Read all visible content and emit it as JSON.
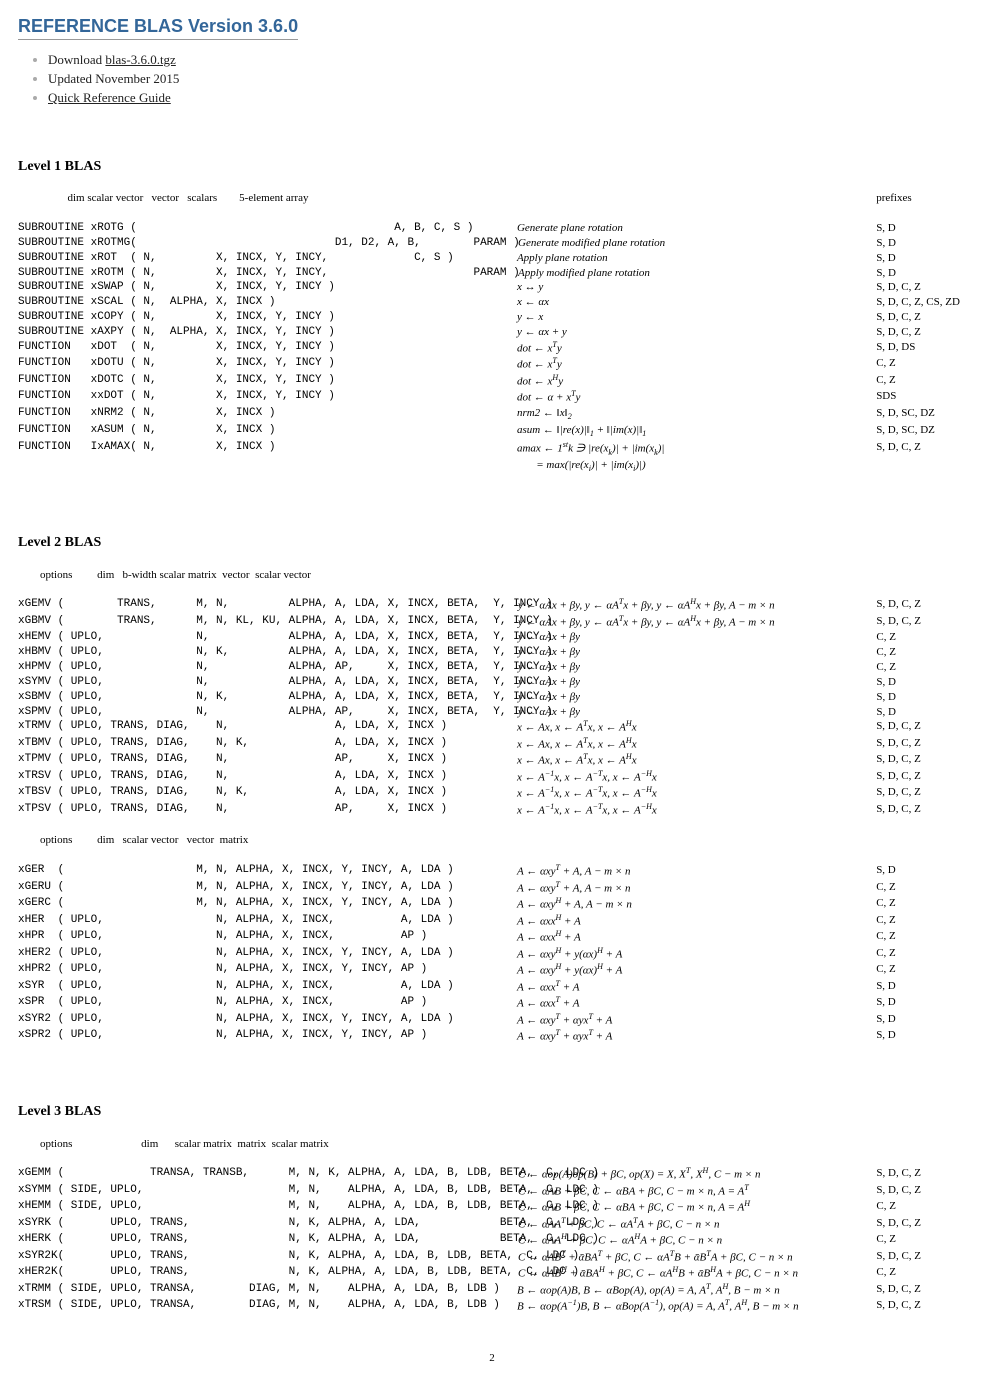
{
  "header": {
    "title": "REFERENCE BLAS Version 3.6.0",
    "items": [
      {
        "pre": "Download ",
        "link": "blas-3.6.0.tgz"
      },
      {
        "text": "Updated November 2015"
      },
      {
        "link": "Quick Reference Guide"
      }
    ]
  },
  "page_number": "2",
  "level1": {
    "title": "Level 1 BLAS",
    "header_c1": "                  dim scalar vector   vector   scalars        5-element array",
    "header_c3": "prefixes",
    "rows": [
      {
        "c1": "SUBROUTINE xROTG (                                       A, B, C, S )",
        "c2": "Generate plane rotation",
        "c3": "S, D"
      },
      {
        "c1": "SUBROUTINE xROTMG(                              D1, D2, A, B,        PARAM )",
        "c2": "Generate modified plane rotation",
        "c3": "S, D"
      },
      {
        "c1": "SUBROUTINE xROT  ( N,         X, INCX, Y, INCY,             C, S )",
        "c2": "Apply plane rotation",
        "c3": "S, D"
      },
      {
        "c1": "SUBROUTINE xROTM ( N,         X, INCX, Y, INCY,                      PARAM )",
        "c2": "Apply modified plane rotation",
        "c3": "S, D"
      },
      {
        "c1": "SUBROUTINE xSWAP ( N,         X, INCX, Y, INCY )",
        "c2": "x ↔ y",
        "c3": "S, D, C, Z"
      },
      {
        "c1": "SUBROUTINE xSCAL ( N,  ALPHA, X, INCX )",
        "c2": "x ← αx",
        "c3": "S, D, C, Z, CS, ZD"
      },
      {
        "c1": "SUBROUTINE xCOPY ( N,         X, INCX, Y, INCY )",
        "c2": "y ← x",
        "c3": "S, D, C, Z"
      },
      {
        "c1": "SUBROUTINE xAXPY ( N,  ALPHA, X, INCX, Y, INCY )",
        "c2": "y ← αx + y",
        "c3": "S, D, C, Z"
      },
      {
        "c1": "FUNCTION   xDOT  ( N,         X, INCX, Y, INCY )",
        "c2": "dot ← x<sup>T</sup>y",
        "c3": "S, D, DS"
      },
      {
        "c1": "FUNCTION   xDOTU ( N,         X, INCX, Y, INCY )",
        "c2": "dot ← x<sup>T</sup>y",
        "c3": "C, Z"
      },
      {
        "c1": "FUNCTION   xDOTC ( N,         X, INCX, Y, INCY )",
        "c2": "dot ← x<sup>H</sup>y",
        "c3": "C, Z"
      },
      {
        "c1": "FUNCTION   xxDOT ( N,         X, INCX, Y, INCY )",
        "c2": "dot ← α + x<sup>T</sup>y",
        "c3": "SDS"
      },
      {
        "c1": "FUNCTION   xNRM2 ( N,         X, INCX )",
        "c2": "nrm2 ← ‖x‖<sub>2</sub>",
        "c3": "S, D, SC, DZ"
      },
      {
        "c1": "FUNCTION   xASUM ( N,         X, INCX )",
        "c2": "asum ← ‖|re(x)|‖<sub>1</sub> + ‖|im(x)|‖<sub>1</sub>",
        "c3": "S, D, SC, DZ"
      },
      {
        "c1": "FUNCTION   IxAMAX( N,         X, INCX )",
        "c2": "amax ← 1<sup>st</sup>k ∋ |re(x<sub>k</sub>)| + |im(x<sub>k</sub>)|",
        "c3": "S, D, C, Z"
      },
      {
        "c1": "",
        "c2": "&nbsp;&nbsp;&nbsp;&nbsp;&nbsp;&nbsp;&nbsp;= max(|re(x<sub>i</sub>)| + |im(x<sub>i</sub>)|)",
        "c3": ""
      }
    ]
  },
  "level2": {
    "title": "Level 2 BLAS",
    "header_c1a": "        options         dim   b-width scalar matrix  vector  scalar vector",
    "header_c1b": "        options         dim   scalar vector   vector  matrix",
    "rows_a": [
      {
        "c1": "xGEMV (        TRANS,      M, N,         ALPHA, A, LDA, X, INCX, BETA,  Y, INCY )",
        "c2": "y ← αAx + βy, y ← αA<sup>T</sup>x + βy, y ← αA<sup>H</sup>x + βy, A − m × n",
        "c3": "S, D, C, Z"
      },
      {
        "c1": "xGBMV (        TRANS,      M, N, KL, KU, ALPHA, A, LDA, X, INCX, BETA,  Y, INCY )",
        "c2": "y ← αAx + βy, y ← αA<sup>T</sup>x + βy, y ← αA<sup>H</sup>x + βy, A − m × n",
        "c3": "S, D, C, Z"
      },
      {
        "c1": "xHEMV ( UPLO,              N,            ALPHA, A, LDA, X, INCX, BETA,  Y, INCY )",
        "c2": "y ← αAx + βy",
        "c3": "C, Z"
      },
      {
        "c1": "xHBMV ( UPLO,              N, K,         ALPHA, A, LDA, X, INCX, BETA,  Y, INCY )",
        "c2": "y ← αAx + βy",
        "c3": "C, Z"
      },
      {
        "c1": "xHPMV ( UPLO,              N,            ALPHA, AP,     X, INCX, BETA,  Y, INCY )",
        "c2": "y ← αAx + βy",
        "c3": "C, Z"
      },
      {
        "c1": "xSYMV ( UPLO,              N,            ALPHA, A, LDA, X, INCX, BETA,  Y, INCY )",
        "c2": "y ← αAx + βy",
        "c3": "S, D"
      },
      {
        "c1": "xSBMV ( UPLO,              N, K,         ALPHA, A, LDA, X, INCX, BETA,  Y, INCY )",
        "c2": "y ← αAx + βy",
        "c3": "S, D"
      },
      {
        "c1": "xSPMV ( UPLO,              N,            ALPHA, AP,     X, INCX, BETA,  Y, INCY )",
        "c2": "y ← αAx + βy",
        "c3": "S, D"
      },
      {
        "c1": "xTRMV ( UPLO, TRANS, DIAG,    N,                A, LDA, X, INCX )",
        "c2": "x ← Ax, x ← A<sup>T</sup>x, x ← A<sup>H</sup>x",
        "c3": "S, D, C, Z"
      },
      {
        "c1": "xTBMV ( UPLO, TRANS, DIAG,    N, K,             A, LDA, X, INCX )",
        "c2": "x ← Ax, x ← A<sup>T</sup>x, x ← A<sup>H</sup>x",
        "c3": "S, D, C, Z"
      },
      {
        "c1": "xTPMV ( UPLO, TRANS, DIAG,    N,                AP,     X, INCX )",
        "c2": "x ← Ax, x ← A<sup>T</sup>x, x ← A<sup>H</sup>x",
        "c3": "S, D, C, Z"
      },
      {
        "c1": "xTRSV ( UPLO, TRANS, DIAG,    N,                A, LDA, X, INCX )",
        "c2": "x ← A<sup>−1</sup>x, x ← A<sup>−T</sup>x, x ← A<sup>−H</sup>x",
        "c3": "S, D, C, Z"
      },
      {
        "c1": "xTBSV ( UPLO, TRANS, DIAG,    N, K,             A, LDA, X, INCX )",
        "c2": "x ← A<sup>−1</sup>x, x ← A<sup>−T</sup>x, x ← A<sup>−H</sup>x",
        "c3": "S, D, C, Z"
      },
      {
        "c1": "xTPSV ( UPLO, TRANS, DIAG,    N,                AP,     X, INCX )",
        "c2": "x ← A<sup>−1</sup>x, x ← A<sup>−T</sup>x, x ← A<sup>−H</sup>x",
        "c3": "S, D, C, Z"
      }
    ],
    "rows_b": [
      {
        "c1": "xGER  (                    M, N, ALPHA, X, INCX, Y, INCY, A, LDA )",
        "c2": "A ← αxy<sup>T</sup> + A, A − m × n",
        "c3": "S, D"
      },
      {
        "c1": "xGERU (                    M, N, ALPHA, X, INCX, Y, INCY, A, LDA )",
        "c2": "A ← αxy<sup>T</sup> + A, A − m × n",
        "c3": "C, Z"
      },
      {
        "c1": "xGERC (                    M, N, ALPHA, X, INCX, Y, INCY, A, LDA )",
        "c2": "A ← αxy<sup>H</sup> + A, A − m × n",
        "c3": "C, Z"
      },
      {
        "c1": "xHER  ( UPLO,                 N, ALPHA, X, INCX,          A, LDA )",
        "c2": "A ← αxx<sup>H</sup> + A",
        "c3": "C, Z"
      },
      {
        "c1": "xHPR  ( UPLO,                 N, ALPHA, X, INCX,          AP )",
        "c2": "A ← αxx<sup>H</sup> + A",
        "c3": "C, Z"
      },
      {
        "c1": "xHER2 ( UPLO,                 N, ALPHA, X, INCX, Y, INCY, A, LDA )",
        "c2": "A ← αxy<sup>H</sup> + y(αx)<sup>H</sup> + A",
        "c3": "C, Z"
      },
      {
        "c1": "xHPR2 ( UPLO,                 N, ALPHA, X, INCX, Y, INCY, AP )",
        "c2": "A ← αxy<sup>H</sup> + y(αx)<sup>H</sup> + A",
        "c3": "C, Z"
      },
      {
        "c1": "xSYR  ( UPLO,                 N, ALPHA, X, INCX,          A, LDA )",
        "c2": "A ← αxx<sup>T</sup> + A",
        "c3": "S, D"
      },
      {
        "c1": "xSPR  ( UPLO,                 N, ALPHA, X, INCX,          AP )",
        "c2": "A ← αxx<sup>T</sup> + A",
        "c3": "S, D"
      },
      {
        "c1": "xSYR2 ( UPLO,                 N, ALPHA, X, INCX, Y, INCY, A, LDA )",
        "c2": "A ← αxy<sup>T</sup> + αyx<sup>T</sup> + A",
        "c3": "S, D"
      },
      {
        "c1": "xSPR2 ( UPLO,                 N, ALPHA, X, INCX, Y, INCY, AP )",
        "c2": "A ← αxy<sup>T</sup> + αyx<sup>T</sup> + A",
        "c3": "S, D"
      }
    ]
  },
  "level3": {
    "title": "Level 3 BLAS",
    "header_c1": "        options                         dim      scalar matrix  matrix  scalar matrix",
    "rows": [
      {
        "c1": "xGEMM (             TRANSA, TRANSB,      M, N, K, ALPHA, A, LDA, B, LDB, BETA,  C, LDC )",
        "c2": "C ← αop(A)op(B) + βC, op(X) = X, X<sup>T</sup>, X<sup>H</sup>, C − m × n",
        "c3": "S, D, C, Z"
      },
      {
        "c1": "xSYMM ( SIDE, UPLO,                      M, N,    ALPHA, A, LDA, B, LDB, BETA,  C, LDC )",
        "c2": "C ← αAB + βC, C ← αBA + βC, C − m × n, A = A<sup>T</sup>",
        "c3": "S, D, C, Z"
      },
      {
        "c1": "xHEMM ( SIDE, UPLO,                      M, N,    ALPHA, A, LDA, B, LDB, BETA,  C, LDC )",
        "c2": "C ← αAB + βC, C ← αBA + βC, C − m × n, A = A<sup>H</sup>",
        "c3": "C, Z"
      },
      {
        "c1": "xSYRK (       UPLO, TRANS,               N, K, ALPHA, A, LDA,            BETA,  C, LDC )",
        "c2": "C ← αAA<sup>T</sup> + βC, C ← αA<sup>T</sup>A + βC, C − n × n",
        "c3": "S, D, C, Z"
      },
      {
        "c1": "xHERK (       UPLO, TRANS,               N, K, ALPHA, A, LDA,            BETA,  C, LDC )",
        "c2": "C ← αAA<sup>H</sup> + βC, C ← αA<sup>H</sup>A + βC, C − n × n",
        "c3": "C, Z"
      },
      {
        "c1": "xSYR2K(       UPLO, TRANS,               N, K, ALPHA, A, LDA, B, LDB, BETA,  C, LDC )",
        "c2": "C ← αAB<sup>T</sup> + ᾱBA<sup>T</sup> + βC, C ← αA<sup>T</sup>B + ᾱB<sup>T</sup>A + βC, C − n × n",
        "c3": "S, D, C, Z"
      },
      {
        "c1": "xHER2K(       UPLO, TRANS,               N, K, ALPHA, A, LDA, B, LDB, BETA,  C, LDC )",
        "c2": "C ← αAB<sup>H</sup> + ᾱBA<sup>H</sup> + βC, C ← αA<sup>H</sup>B + ᾱB<sup>H</sup>A + βC, C − n × n",
        "c3": "C, Z"
      },
      {
        "c1": "xTRMM ( SIDE, UPLO, TRANSA,        DIAG, M, N,    ALPHA, A, LDA, B, LDB )",
        "c2": "B ← αop(A)B, B ← αBop(A), op(A) = A, A<sup>T</sup>, A<sup>H</sup>, B − m × n",
        "c3": "S, D, C, Z"
      },
      {
        "c1": "xTRSM ( SIDE, UPLO, TRANSA,        DIAG, M, N,    ALPHA, A, LDA, B, LDB )",
        "c2": "B ← αop(A<sup>−1</sup>)B, B ← αBop(A<sup>−1</sup>), op(A) = A, A<sup>T</sup>, A<sup>H</sup>, B − m × n",
        "c3": "S, D, C, Z"
      }
    ]
  }
}
